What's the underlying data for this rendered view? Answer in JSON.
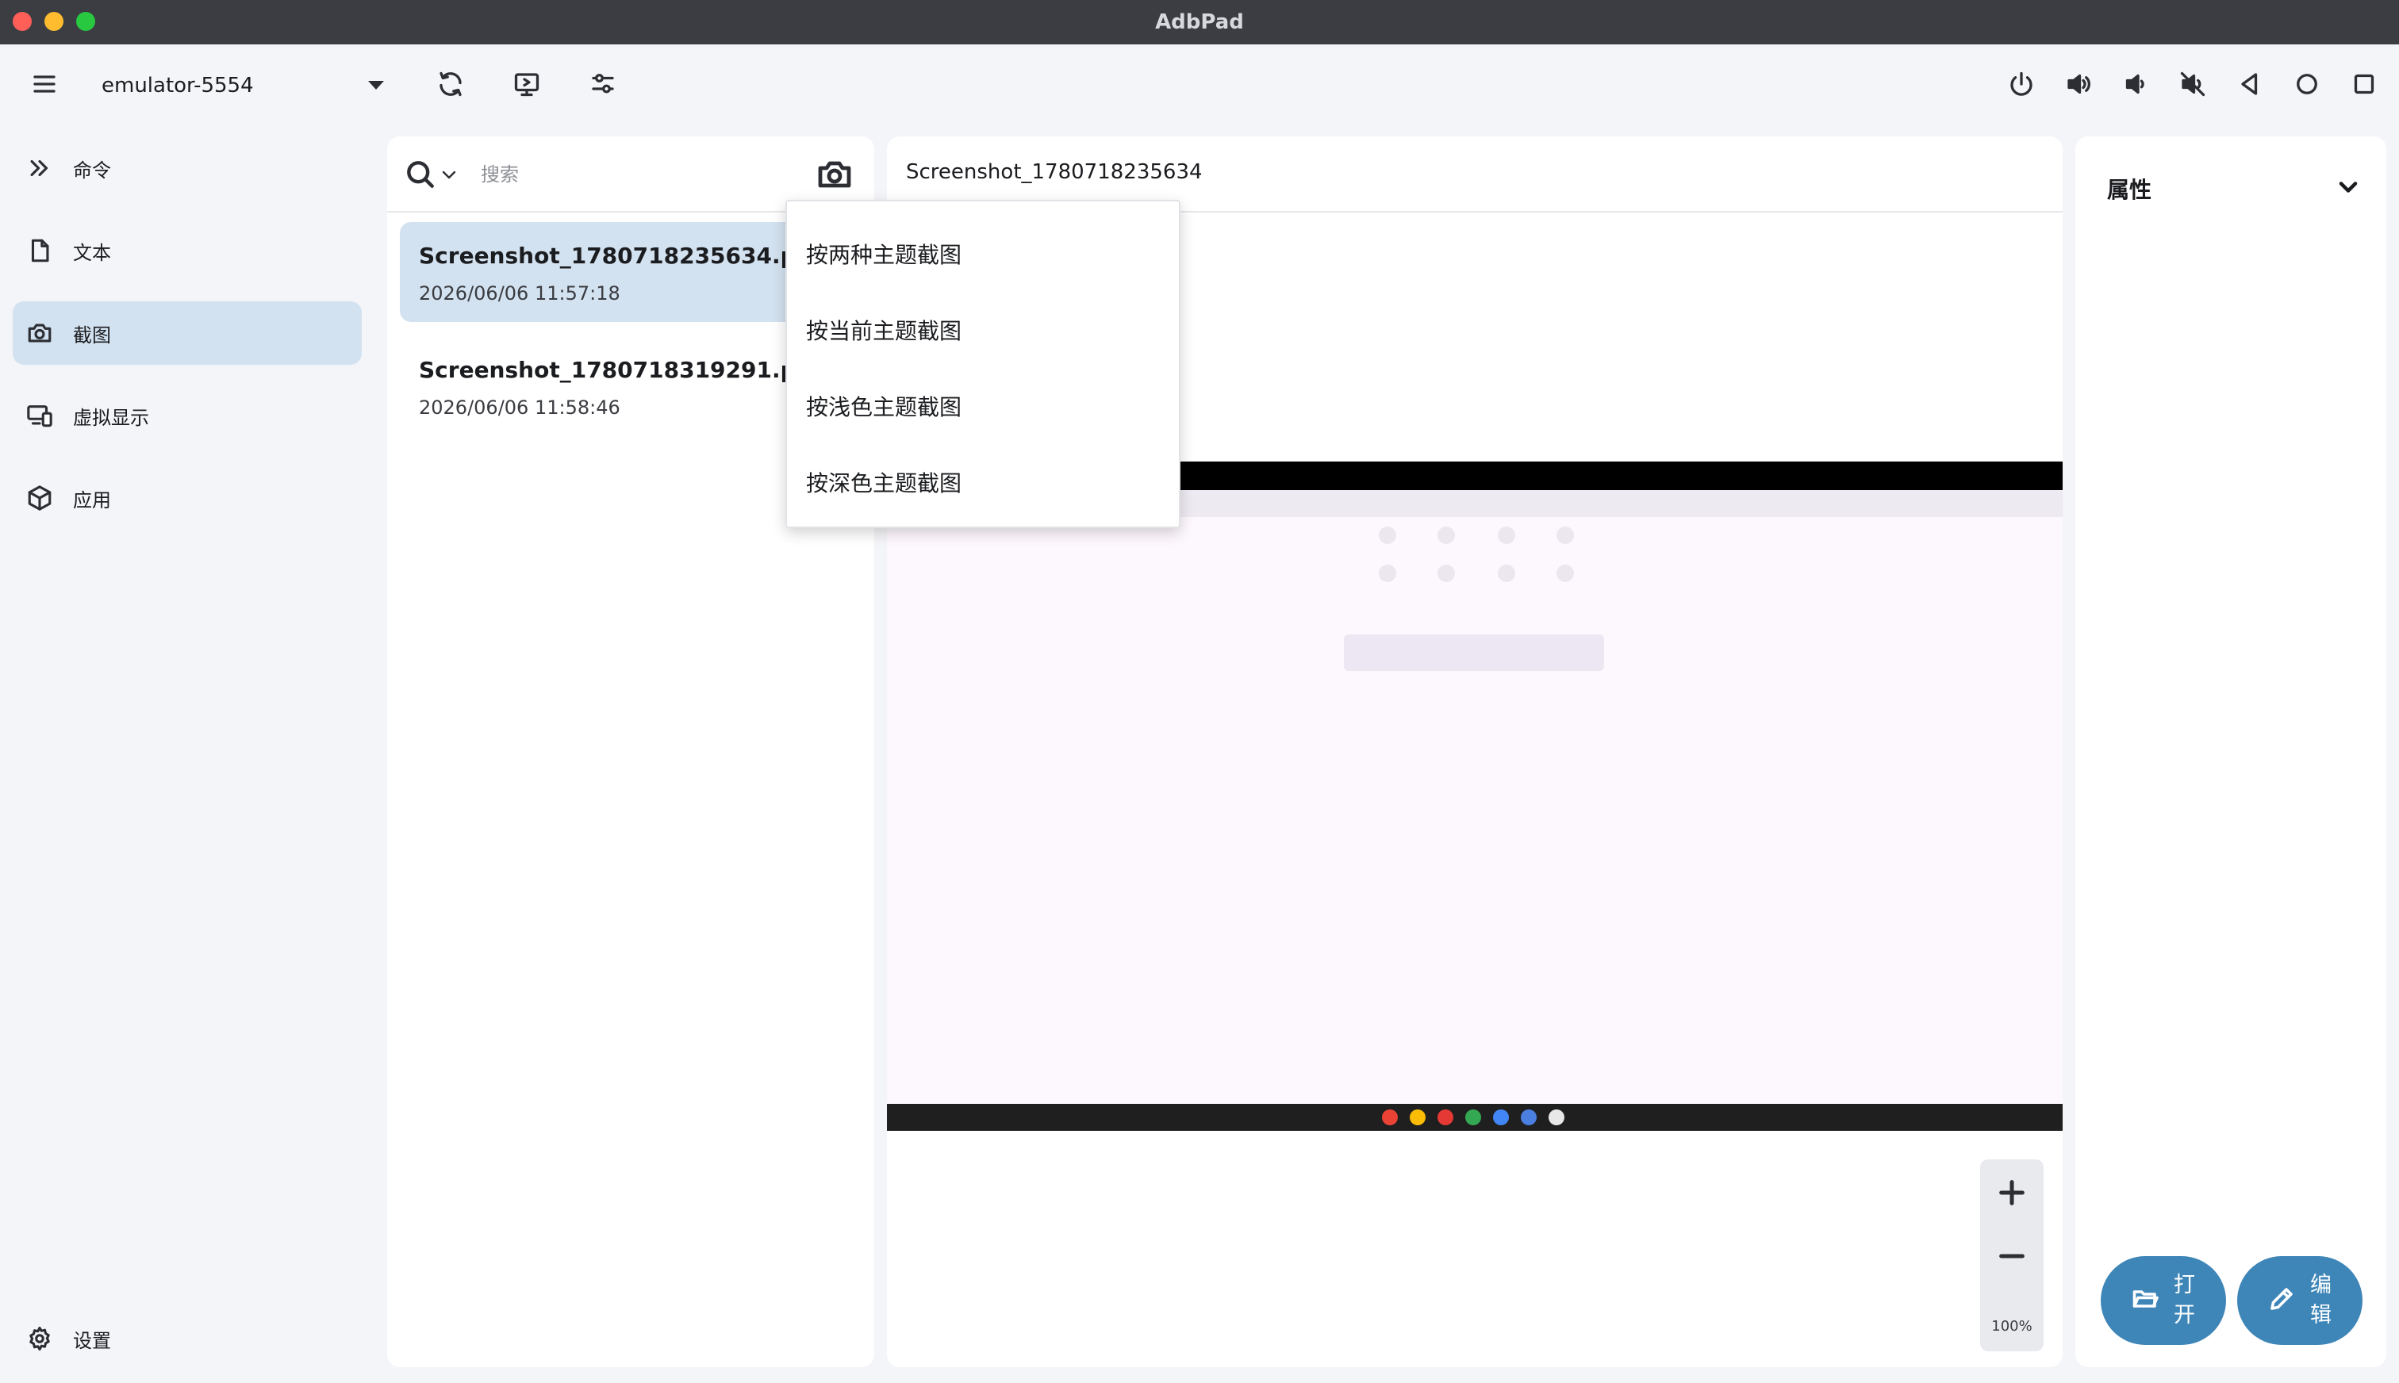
{
  "window": {
    "title": "AdbPad"
  },
  "toolbar": {
    "device": "emulator-5554",
    "left_icons": [
      "menu-icon",
      "refresh-icon",
      "screen-mirror-icon",
      "adjust-icon"
    ],
    "right_icons": [
      "power-icon",
      "volume-up-icon",
      "volume-down-icon",
      "mute-icon",
      "back-icon",
      "home-icon",
      "recents-icon"
    ]
  },
  "sidebar": {
    "items": [
      {
        "label": "命令",
        "icon": "double-chevron-icon"
      },
      {
        "label": "文本",
        "icon": "document-icon"
      },
      {
        "label": "截图",
        "icon": "camera-icon",
        "active": true
      },
      {
        "label": "虚拟显示",
        "icon": "virtual-display-icon"
      },
      {
        "label": "应用",
        "icon": "package-icon"
      }
    ],
    "settings_label": "设置"
  },
  "list": {
    "search_placeholder": "搜索",
    "files": [
      {
        "name": "Screenshot_1780718235634.png",
        "date": "2026/06/06 11:57:18",
        "selected": true
      },
      {
        "name": "Screenshot_1780718319291.png",
        "date": "2026/06/06 11:58:46",
        "selected": false
      }
    ]
  },
  "menu": {
    "items": [
      "按两种主题截图",
      "按当前主题截图",
      "按浅色主题截图",
      "按深色主题截图"
    ]
  },
  "preview": {
    "title": "Screenshot_1780718235634",
    "zoom": "100%"
  },
  "props": {
    "title": "属性"
  },
  "actions": {
    "open_label": "打开",
    "edit_label": "编辑"
  },
  "colors": {
    "accent": "#3f86b8",
    "selection": "#d3e2f0",
    "background": "#f4f5f8"
  }
}
